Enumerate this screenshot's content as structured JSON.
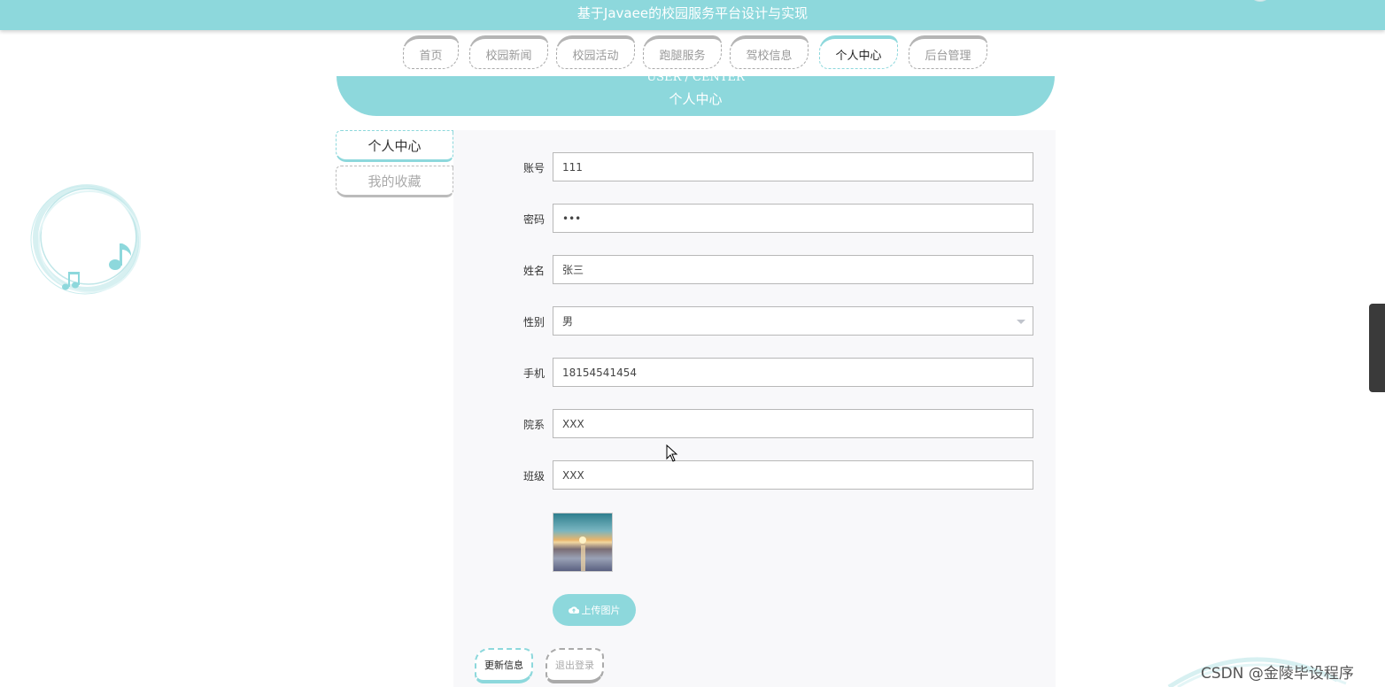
{
  "header": {
    "title": "基于Javaee的校园服务平台设计与实现"
  },
  "nav": {
    "items": [
      "首页",
      "校园新闻",
      "校园活动",
      "跑腿服务",
      "驾校信息",
      "个人中心",
      "后台管理"
    ],
    "active": "个人中心"
  },
  "banner": {
    "en": "USER / CENTER",
    "cn": "个人中心"
  },
  "sidebar": {
    "items": [
      "个人中心",
      "我的收藏"
    ]
  },
  "form": {
    "account": {
      "label": "账号",
      "value": "111"
    },
    "password": {
      "label": "密码",
      "value": "•••"
    },
    "name": {
      "label": "姓名",
      "value": "张三"
    },
    "gender": {
      "label": "性别",
      "value": "男"
    },
    "phone": {
      "label": "手机",
      "value": "18154541454"
    },
    "department": {
      "label": "院系",
      "value": "XXX"
    },
    "class": {
      "label": "班级",
      "value": "XXX"
    }
  },
  "upload": {
    "label": "上传图片",
    "icon": "cloud-upload-icon"
  },
  "actions": {
    "update": "更新信息",
    "logout": "退出登录"
  },
  "watermark": "CSDN @金陵毕设程序",
  "colors": {
    "accent": "#8dd8dc",
    "muted": "#aaaaaa"
  }
}
